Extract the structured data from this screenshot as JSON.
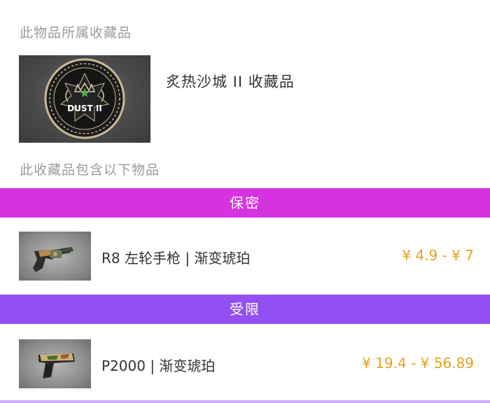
{
  "collection_section": {
    "label": "此物品所属收藏品",
    "collection_name": "炙热沙城 II 收藏品",
    "badge_text": "DUST II"
  },
  "items_section": {
    "label": "此收藏品包含以下物品"
  },
  "rarity_groups": [
    {
      "label": "保密",
      "color": "#d633e0",
      "items": [
        {
          "name": "R8 左轮手枪 | 渐变琥珀",
          "price": "¥ 4.9 - ¥ 7",
          "icon": "revolver-icon"
        }
      ]
    },
    {
      "label": "受限",
      "color": "#9250f2",
      "items": [
        {
          "name": "P2000 | 渐变琥珀",
          "price": "¥ 19.4 - ¥ 56.89",
          "icon": "pistol-icon"
        }
      ]
    }
  ],
  "colors": {
    "label_gray": "#9a9a9a",
    "price_orange": "#e8a21d"
  }
}
